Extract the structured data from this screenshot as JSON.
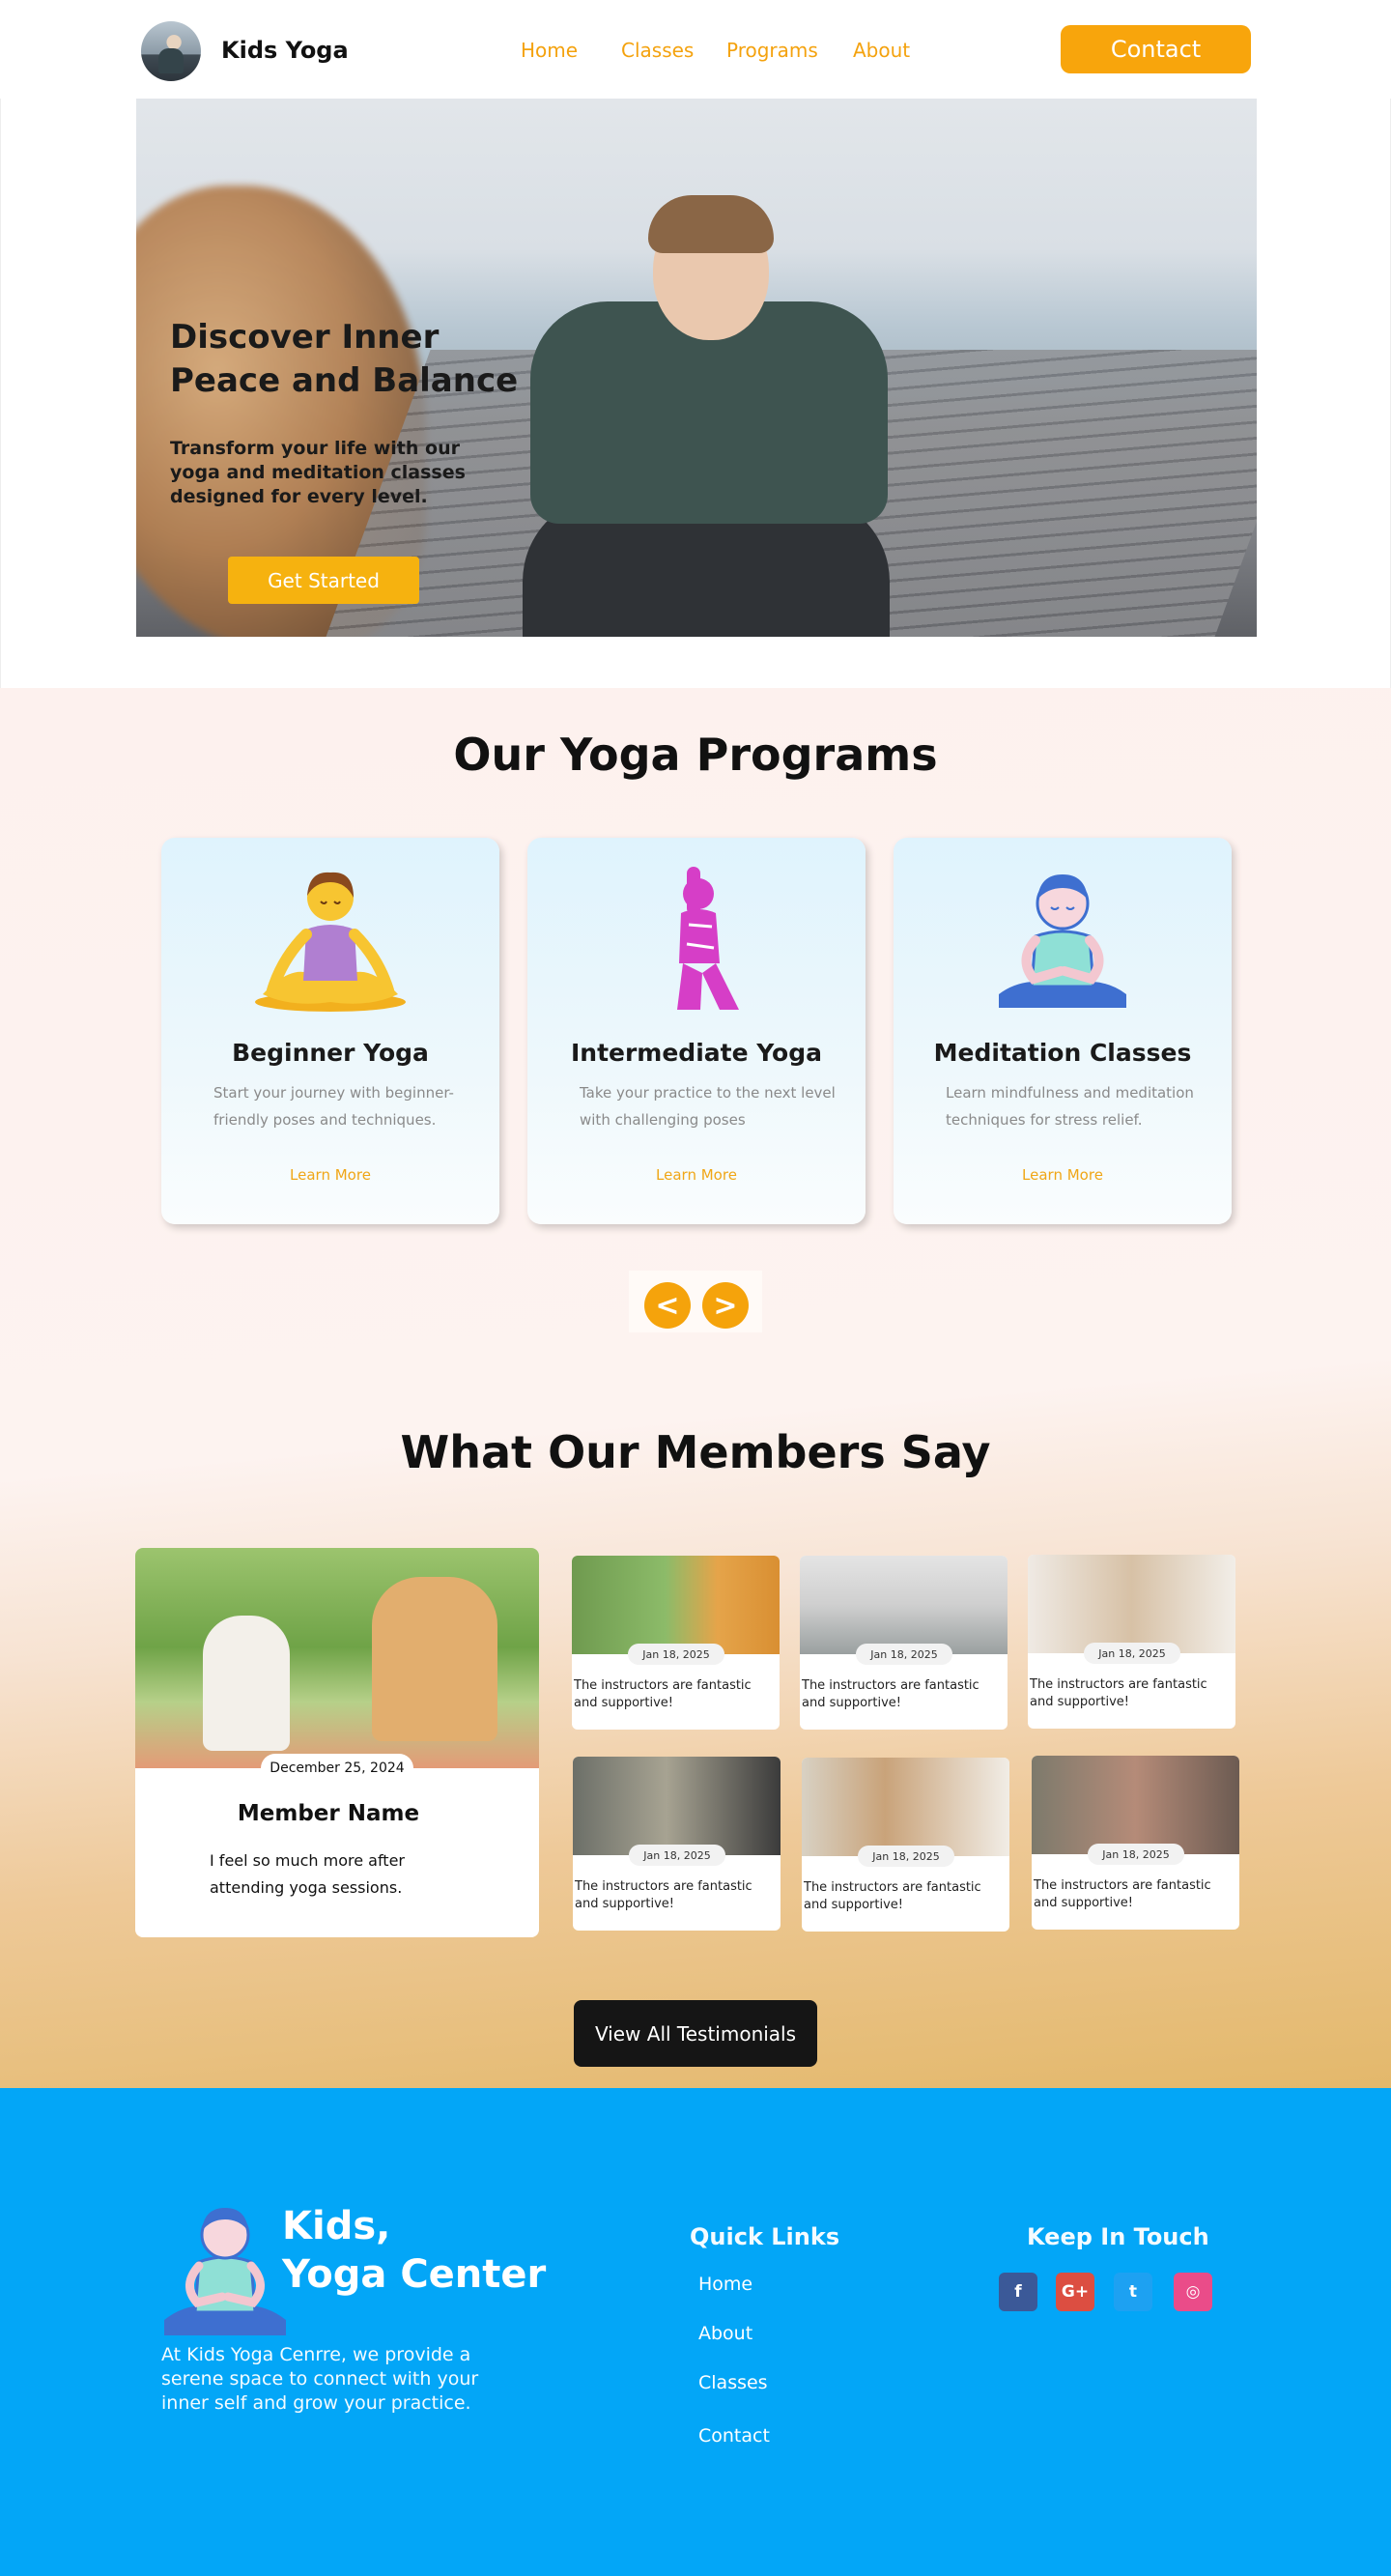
{
  "header": {
    "brand": "Kids Yoga",
    "nav": {
      "home": "Home",
      "classes": "Classes",
      "programs": "Programs",
      "about": "About"
    },
    "contact_label": "Contact",
    "accent": "#f8a50c"
  },
  "hero": {
    "title": "Discover Inner Peace and Balance",
    "subtitle": "Transform your life with our yoga and meditation classes designed for every level.",
    "cta_label": "Get Started"
  },
  "programs": {
    "title": "Our Yoga Programs",
    "cards": [
      {
        "title": "Beginner Yoga",
        "text": "Start your journey with beginner-friendly poses and techniques.",
        "link": "Learn More",
        "icon": "meditating-woman-icon"
      },
      {
        "title": "Intermediate Yoga",
        "text": "Take your practice to the next level with challenging poses",
        "link": "Learn More",
        "icon": "yoga-pose-icon"
      },
      {
        "title": "Meditation Classes",
        "text": "Learn mindfulness and meditation techniques for stress relief.",
        "link": "Learn More",
        "icon": "meditating-person-icon"
      }
    ],
    "prev_label": "<",
    "next_label": ">"
  },
  "testimonials": {
    "title": "What Our Members Say",
    "featured": {
      "date": "December 25, 2024",
      "name": "Member Name",
      "quote": "I feel so much more   after attending yoga sessions."
    },
    "items": [
      {
        "date": "Jan 18, 2025",
        "text": "The instructors are fantastic and supportive!"
      },
      {
        "date": "Jan 18, 2025",
        "text": "The instructors are fantastic and supportive!"
      },
      {
        "date": "Jan 18, 2025",
        "text": "The instructors are fantastic and supportive!"
      },
      {
        "date": "Jan 18, 2025",
        "text": "The instructors are fantastic and supportive!"
      },
      {
        "date": "Jan 18, 2025",
        "text": "The instructors are fantastic and supportive!"
      },
      {
        "date": "Jan 18, 2025",
        "text": "The instructors are fantastic and supportive!"
      }
    ],
    "view_all_label": "View All Testimonials"
  },
  "footer": {
    "brand_line1": "Kids,",
    "brand_line2": "Yoga  Center",
    "about": "At Kids Yoga Cenrre, we provide a serene space to connect with your inner self and grow your practice.",
    "quick_links_title": "Quick Links",
    "quick_links": [
      "Home",
      "About",
      "Classes",
      "Contact"
    ],
    "keep_in_touch_title": "Keep In Touch",
    "social": [
      {
        "icon": "facebook-icon",
        "glyph": "f",
        "color": "#3b5998"
      },
      {
        "icon": "google-plus-icon",
        "glyph": "G+",
        "color": "#dc4e41"
      },
      {
        "icon": "twitter-icon",
        "glyph": "t",
        "color": "#1da1f2"
      },
      {
        "icon": "dribbble-icon",
        "glyph": "◎",
        "color": "#ea4c89"
      }
    ],
    "background": "#03a6f7"
  }
}
